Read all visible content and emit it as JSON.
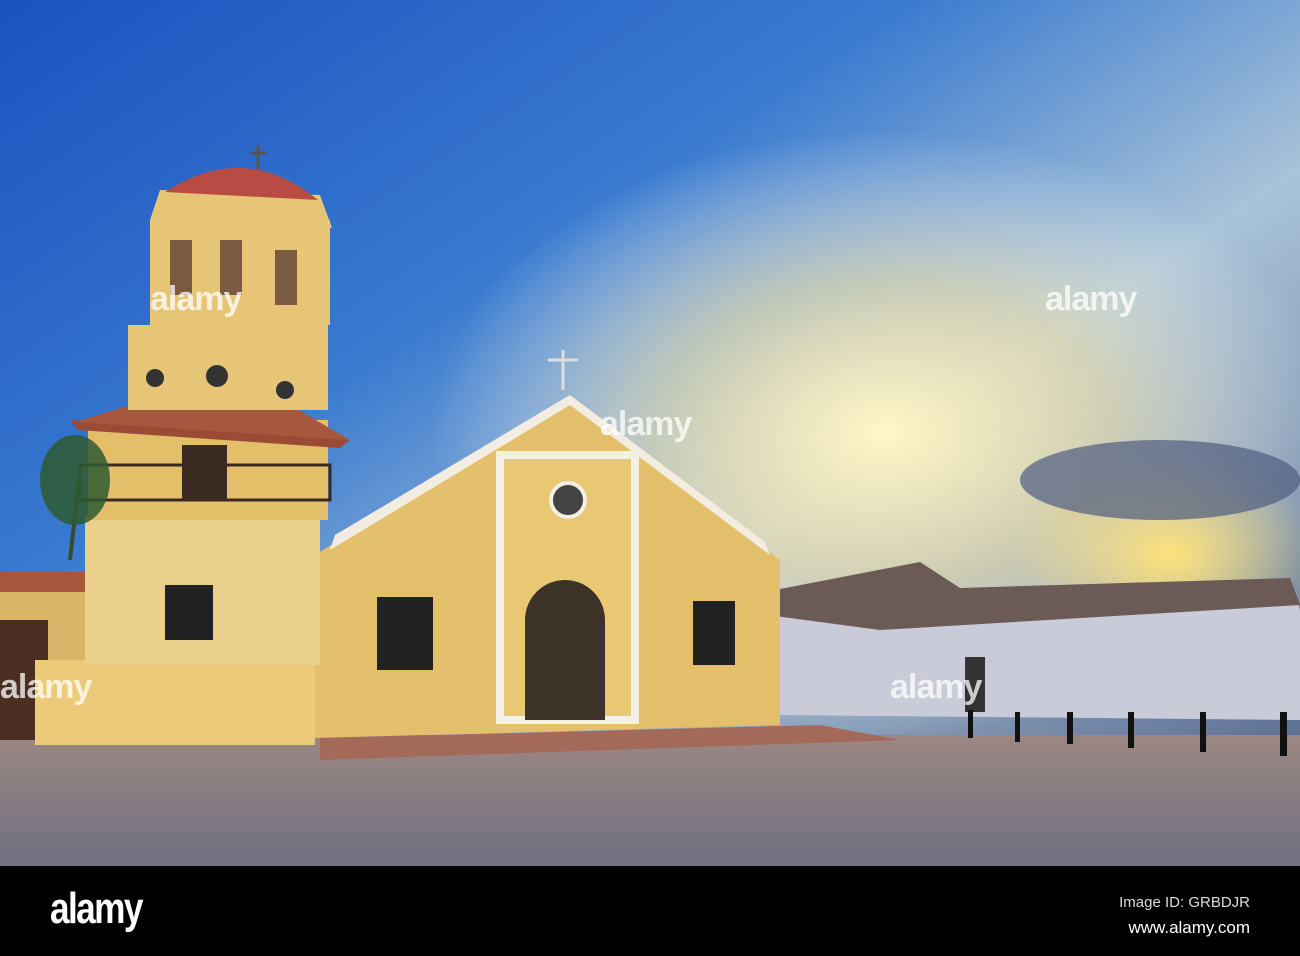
{
  "watermark": {
    "text": "alamy"
  },
  "footer": {
    "logo": "alamy",
    "image_id": "Image ID: GRBDJR",
    "url": "www.alamy.com"
  },
  "colors": {
    "sky_top": "#1f55b8",
    "sky_light": "#fdf4c4",
    "church_yellow": "#e6c36f",
    "plaza": "#8c7c7c"
  }
}
